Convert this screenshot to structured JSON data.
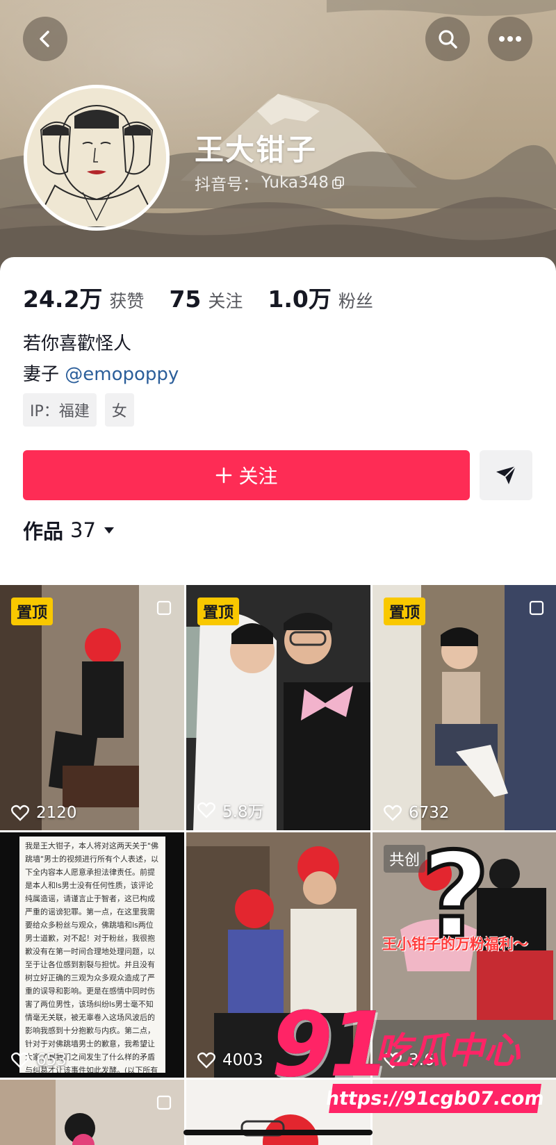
{
  "profile": {
    "name": "王大钳子",
    "douyin_id_label": "抖音号：",
    "douyin_id": "Yuka348"
  },
  "stats": {
    "likes_value": "24.2万",
    "likes_label": "获赞",
    "following_value": "75",
    "following_label": "关注",
    "followers_value": "1.0万",
    "followers_label": "粉丝"
  },
  "bio": {
    "line1": "若你喜歡怪人",
    "line2_prefix": "妻子 ",
    "mention": "@emopoppy"
  },
  "tags": [
    "IP：福建",
    "女"
  ],
  "actions": {
    "follow_label": "关注"
  },
  "works": {
    "label": "作品",
    "count": "37"
  },
  "videos": [
    {
      "badge": "置顶",
      "likes": "2120"
    },
    {
      "badge": "置顶",
      "likes": "5.8万"
    },
    {
      "badge": "置顶",
      "likes": "6732"
    },
    {
      "badge": "",
      "likes": "653"
    },
    {
      "badge": "",
      "likes": "4003"
    },
    {
      "badge": "共创",
      "likes": "3.6",
      "overlay_text": "王小钳子的万粉福利～"
    }
  ],
  "doc_text": "我是王大钳子，本人将对这两天关于\"佛跳墙\"男士的视频进行所有个人表述，以下全内容本人愿意承担法律责任。前提是本人和ls男士没有任何性质，该评论纯属造谣，请谨言止于智者，这已构成严重的谣谤犯罪。第一点，在这里我需要给众多粉丝与观众，佛跳墙和ls两位男士道歉，对不起！对于粉丝，我很抱歉没有在第一时间合理地处理问题，以至于让各位感到割裂与担忧。并且没有树立好正确的三观为众多观众造成了严重的误导和影响。更是在感情中同时伤害了两位男性，该场纠纷ls男士毫不知情毫无关联，被无辜卷入这场风波后的影响我感到十分抱歉与内疚。第二点，针对于对佛跳墙男士的歉意，我希望让大家了解我们之间发生了什么样的矛盾与纠葛才让该事件如此发酵。(以下所有言论本人都愿意承担法律责任) ·我与佛跳墙男士总共在一起三年半时间，在第一年的时间里本人发现了该男士的多次原则性问题并选择原谅他。所谓的你补也无法改变婚姻，本人意识到该问题后…",
  "watermark": {
    "big": "91",
    "title": "吃瓜中心",
    "url": "https://91cgb07.com"
  },
  "colors": {
    "accent": "#fe2c55",
    "pin_badge": "#f9c800",
    "mention": "#2b5e9a"
  }
}
